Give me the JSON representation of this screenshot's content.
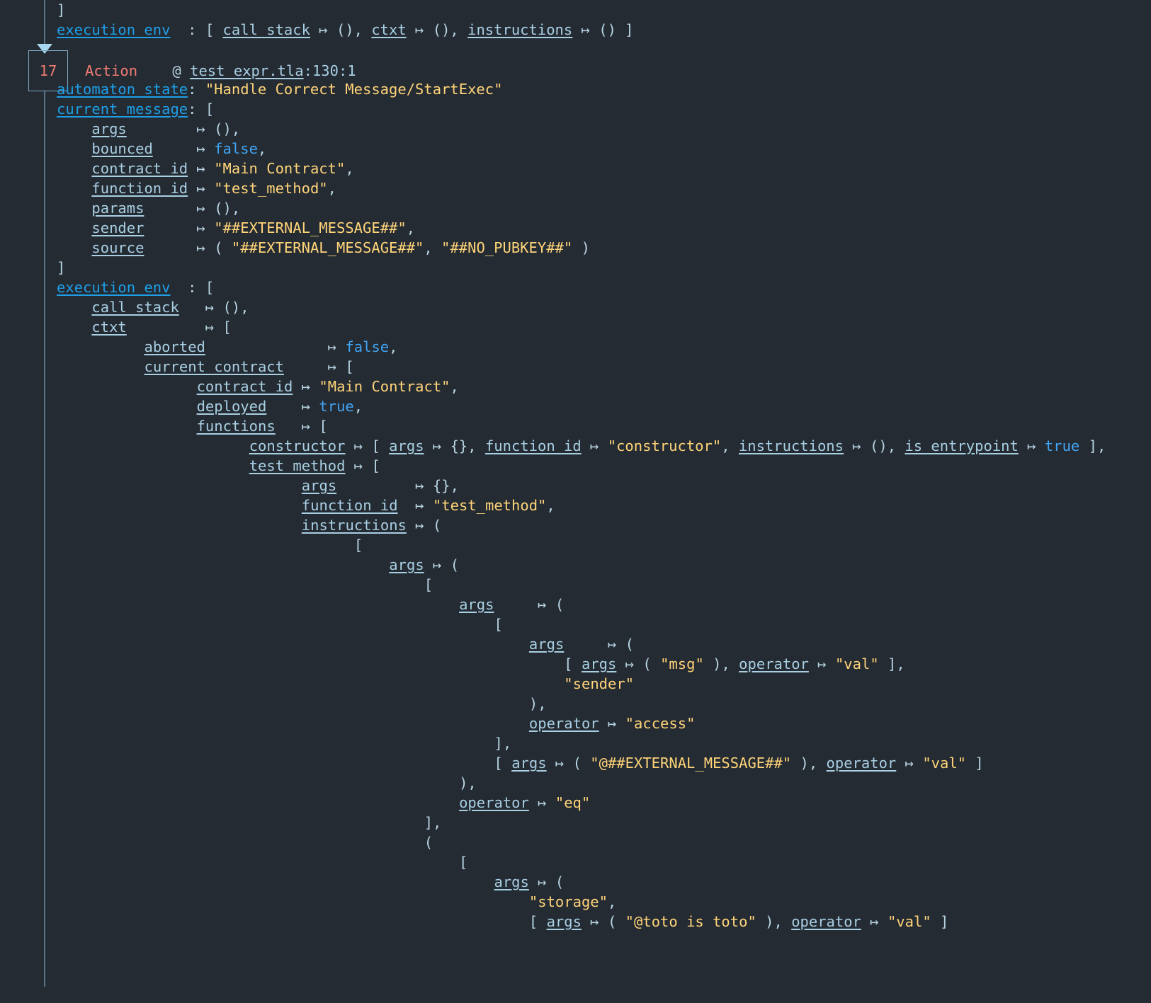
{
  "meta": {
    "background": "#242b33",
    "key_color": "#1e9fe8",
    "subkey_color": "#a9cfe3",
    "string_color": "#ffd479",
    "bool_color": "#42a5f5",
    "action_color": "#f07b72",
    "punct_color": "#b8d4e3",
    "rail_color": "#5a7287"
  },
  "step": {
    "number": "17",
    "kind": "Action",
    "at_symbol": "@",
    "file": "test_expr.tla",
    "location": ":130:1"
  },
  "lines": [
    {
      "indent": 0,
      "tokens": [
        {
          "t": "punct",
          "v": "]"
        }
      ]
    },
    {
      "indent": 0,
      "tokens": [
        {
          "t": "k-top",
          "v": "execution_env"
        },
        {
          "t": "punct",
          "v": "  : [ "
        },
        {
          "t": "k-sub",
          "v": "call_stack"
        },
        {
          "t": "punct",
          "v": " ↦ (), "
        },
        {
          "t": "k-sub",
          "v": "ctxt"
        },
        {
          "t": "punct",
          "v": " ↦ (), "
        },
        {
          "t": "k-sub",
          "v": "instructions"
        },
        {
          "t": "punct",
          "v": " ↦ () ]"
        }
      ]
    },
    {
      "indent": 0,
      "tokens": [],
      "spacer": true
    },
    {
      "indent": 0,
      "tokens": [],
      "spacer": true
    },
    {
      "indent": 0,
      "tokens": [
        {
          "t": "k-top",
          "v": "automaton_state"
        },
        {
          "t": "punct",
          "v": ": "
        },
        {
          "t": "str",
          "v": "\"Handle Correct Message/StartExec\""
        }
      ]
    },
    {
      "indent": 0,
      "tokens": [
        {
          "t": "k-top",
          "v": "current_message"
        },
        {
          "t": "punct",
          "v": ": ["
        }
      ]
    },
    {
      "indent": 2,
      "tokens": [
        {
          "t": "k-sub",
          "v": "args"
        },
        {
          "t": "punct",
          "v": "        ↦ (),"
        }
      ]
    },
    {
      "indent": 2,
      "tokens": [
        {
          "t": "k-sub",
          "v": "bounced"
        },
        {
          "t": "punct",
          "v": "     ↦ "
        },
        {
          "t": "bool",
          "v": "false"
        },
        {
          "t": "punct",
          "v": ","
        }
      ]
    },
    {
      "indent": 2,
      "tokens": [
        {
          "t": "k-sub",
          "v": "contract_id"
        },
        {
          "t": "punct",
          "v": " ↦ "
        },
        {
          "t": "str",
          "v": "\"Main Contract\""
        },
        {
          "t": "punct",
          "v": ","
        }
      ]
    },
    {
      "indent": 2,
      "tokens": [
        {
          "t": "k-sub",
          "v": "function_id"
        },
        {
          "t": "punct",
          "v": " ↦ "
        },
        {
          "t": "str",
          "v": "\"test_method\""
        },
        {
          "t": "punct",
          "v": ","
        }
      ]
    },
    {
      "indent": 2,
      "tokens": [
        {
          "t": "k-sub",
          "v": "params"
        },
        {
          "t": "punct",
          "v": "      ↦ (),"
        }
      ]
    },
    {
      "indent": 2,
      "tokens": [
        {
          "t": "k-sub",
          "v": "sender"
        },
        {
          "t": "punct",
          "v": "      ↦ "
        },
        {
          "t": "str",
          "v": "\"##EXTERNAL_MESSAGE##\""
        },
        {
          "t": "punct",
          "v": ","
        }
      ]
    },
    {
      "indent": 2,
      "tokens": [
        {
          "t": "k-sub",
          "v": "source"
        },
        {
          "t": "punct",
          "v": "      ↦ ( "
        },
        {
          "t": "str",
          "v": "\"##EXTERNAL_MESSAGE##\""
        },
        {
          "t": "punct",
          "v": ", "
        },
        {
          "t": "str",
          "v": "\"##NO_PUBKEY##\""
        },
        {
          "t": "punct",
          "v": " )"
        }
      ]
    },
    {
      "indent": 0,
      "tokens": [
        {
          "t": "punct",
          "v": "]"
        }
      ]
    },
    {
      "indent": 0,
      "tokens": [
        {
          "t": "k-top",
          "v": "execution_env"
        },
        {
          "t": "punct",
          "v": "  : ["
        }
      ]
    },
    {
      "indent": 2,
      "tokens": [
        {
          "t": "k-sub",
          "v": "call_stack"
        },
        {
          "t": "punct",
          "v": "   ↦ (),"
        }
      ]
    },
    {
      "indent": 2,
      "tokens": [
        {
          "t": "k-sub",
          "v": "ctxt"
        },
        {
          "t": "punct",
          "v": "         ↦ ["
        }
      ]
    },
    {
      "indent": 5,
      "tokens": [
        {
          "t": "k-sub",
          "v": "aborted"
        },
        {
          "t": "punct",
          "v": "              ↦ "
        },
        {
          "t": "bool",
          "v": "false"
        },
        {
          "t": "punct",
          "v": ","
        }
      ]
    },
    {
      "indent": 5,
      "tokens": [
        {
          "t": "k-sub",
          "v": "current_contract"
        },
        {
          "t": "punct",
          "v": "     ↦ ["
        }
      ]
    },
    {
      "indent": 8,
      "tokens": [
        {
          "t": "k-sub",
          "v": "contract_id"
        },
        {
          "t": "punct",
          "v": " ↦ "
        },
        {
          "t": "str",
          "v": "\"Main Contract\""
        },
        {
          "t": "punct",
          "v": ","
        }
      ]
    },
    {
      "indent": 8,
      "tokens": [
        {
          "t": "k-sub",
          "v": "deployed"
        },
        {
          "t": "punct",
          "v": "    ↦ "
        },
        {
          "t": "bool",
          "v": "true"
        },
        {
          "t": "punct",
          "v": ","
        }
      ]
    },
    {
      "indent": 8,
      "tokens": [
        {
          "t": "k-sub",
          "v": "functions"
        },
        {
          "t": "punct",
          "v": "   ↦ ["
        }
      ]
    },
    {
      "indent": 11,
      "tokens": [
        {
          "t": "k-sub",
          "v": "constructor"
        },
        {
          "t": "punct",
          "v": " ↦ [ "
        },
        {
          "t": "k-sub",
          "v": "args"
        },
        {
          "t": "punct",
          "v": " ↦ {}, "
        },
        {
          "t": "k-sub",
          "v": "function_id"
        },
        {
          "t": "punct",
          "v": " ↦ "
        },
        {
          "t": "str",
          "v": "\"constructor\""
        },
        {
          "t": "punct",
          "v": ", "
        },
        {
          "t": "k-sub",
          "v": "instructions"
        },
        {
          "t": "punct",
          "v": " ↦ (), "
        },
        {
          "t": "k-sub",
          "v": "is_entrypoint"
        },
        {
          "t": "punct",
          "v": " ↦ "
        },
        {
          "t": "bool",
          "v": "true"
        },
        {
          "t": "punct",
          "v": " ],"
        }
      ]
    },
    {
      "indent": 11,
      "tokens": [
        {
          "t": "k-sub",
          "v": "test_method"
        },
        {
          "t": "punct",
          "v": " ↦ ["
        }
      ]
    },
    {
      "indent": 14,
      "tokens": [
        {
          "t": "k-sub",
          "v": "args"
        },
        {
          "t": "punct",
          "v": "         ↦ {},"
        }
      ]
    },
    {
      "indent": 14,
      "tokens": [
        {
          "t": "k-sub",
          "v": "function_id"
        },
        {
          "t": "punct",
          "v": "  ↦ "
        },
        {
          "t": "str",
          "v": "\"test_method\""
        },
        {
          "t": "punct",
          "v": ","
        }
      ]
    },
    {
      "indent": 14,
      "tokens": [
        {
          "t": "k-sub",
          "v": "instructions"
        },
        {
          "t": "punct",
          "v": " ↦ ("
        }
      ]
    },
    {
      "indent": 17,
      "tokens": [
        {
          "t": "punct",
          "v": "["
        }
      ]
    },
    {
      "indent": 19,
      "tokens": [
        {
          "t": "k-sub",
          "v": "args"
        },
        {
          "t": "punct",
          "v": " ↦ ("
        }
      ]
    },
    {
      "indent": 21,
      "tokens": [
        {
          "t": "punct",
          "v": "["
        }
      ]
    },
    {
      "indent": 23,
      "tokens": [
        {
          "t": "k-sub",
          "v": "args"
        },
        {
          "t": "punct",
          "v": "     ↦ ("
        }
      ]
    },
    {
      "indent": 25,
      "tokens": [
        {
          "t": "punct",
          "v": "["
        }
      ]
    },
    {
      "indent": 27,
      "tokens": [
        {
          "t": "k-sub",
          "v": "args"
        },
        {
          "t": "punct",
          "v": "     ↦ ("
        }
      ]
    },
    {
      "indent": 29,
      "tokens": [
        {
          "t": "punct",
          "v": "[ "
        },
        {
          "t": "k-sub",
          "v": "args"
        },
        {
          "t": "punct",
          "v": " ↦ ( "
        },
        {
          "t": "str",
          "v": "\"msg\""
        },
        {
          "t": "punct",
          "v": " ), "
        },
        {
          "t": "k-sub",
          "v": "operator"
        },
        {
          "t": "punct",
          "v": " ↦ "
        },
        {
          "t": "str",
          "v": "\"val\""
        },
        {
          "t": "punct",
          "v": " ],"
        }
      ]
    },
    {
      "indent": 29,
      "tokens": [
        {
          "t": "str",
          "v": "\"sender\""
        }
      ]
    },
    {
      "indent": 27,
      "tokens": [
        {
          "t": "punct",
          "v": "),"
        }
      ]
    },
    {
      "indent": 27,
      "tokens": [
        {
          "t": "k-sub",
          "v": "operator"
        },
        {
          "t": "punct",
          "v": " ↦ "
        },
        {
          "t": "str",
          "v": "\"access\""
        }
      ]
    },
    {
      "indent": 25,
      "tokens": [
        {
          "t": "punct",
          "v": "],"
        }
      ]
    },
    {
      "indent": 25,
      "tokens": [
        {
          "t": "punct",
          "v": "[ "
        },
        {
          "t": "k-sub",
          "v": "args"
        },
        {
          "t": "punct",
          "v": " ↦ ( "
        },
        {
          "t": "str",
          "v": "\"@##EXTERNAL_MESSAGE##\""
        },
        {
          "t": "punct",
          "v": " ), "
        },
        {
          "t": "k-sub",
          "v": "operator"
        },
        {
          "t": "punct",
          "v": " ↦ "
        },
        {
          "t": "str",
          "v": "\"val\""
        },
        {
          "t": "punct",
          "v": " ]"
        }
      ]
    },
    {
      "indent": 23,
      "tokens": [
        {
          "t": "punct",
          "v": "),"
        }
      ]
    },
    {
      "indent": 23,
      "tokens": [
        {
          "t": "k-sub",
          "v": "operator"
        },
        {
          "t": "punct",
          "v": " ↦ "
        },
        {
          "t": "str",
          "v": "\"eq\""
        }
      ]
    },
    {
      "indent": 21,
      "tokens": [
        {
          "t": "punct",
          "v": "],"
        }
      ]
    },
    {
      "indent": 21,
      "tokens": [
        {
          "t": "punct",
          "v": "("
        }
      ]
    },
    {
      "indent": 23,
      "tokens": [
        {
          "t": "punct",
          "v": "["
        }
      ]
    },
    {
      "indent": 25,
      "tokens": [
        {
          "t": "k-sub",
          "v": "args"
        },
        {
          "t": "punct",
          "v": " ↦ ("
        }
      ]
    },
    {
      "indent": 27,
      "tokens": [
        {
          "t": "str",
          "v": "\"storage\""
        },
        {
          "t": "punct",
          "v": ","
        }
      ]
    },
    {
      "indent": 27,
      "tokens": [
        {
          "t": "punct",
          "v": "[ "
        },
        {
          "t": "k-sub",
          "v": "args"
        },
        {
          "t": "punct",
          "v": " ↦ ( "
        },
        {
          "t": "str",
          "v": "\"@toto is toto\""
        },
        {
          "t": "punct",
          "v": " ), "
        },
        {
          "t": "k-sub",
          "v": "operator"
        },
        {
          "t": "punct",
          "v": " ↦ "
        },
        {
          "t": "str",
          "v": "\"val\""
        },
        {
          "t": "punct",
          "v": " ]"
        }
      ]
    }
  ]
}
